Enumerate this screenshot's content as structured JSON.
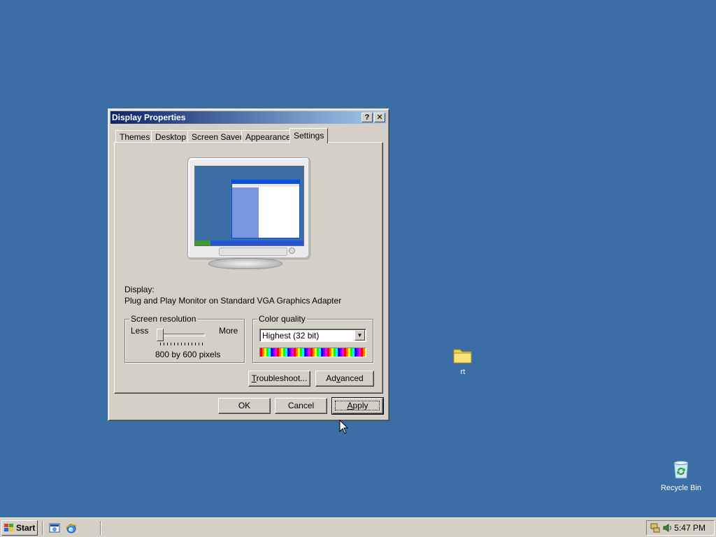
{
  "desktop": {
    "background": "#3a6ea5",
    "icons": [
      {
        "label": "rt",
        "icon": "folder-icon"
      },
      {
        "label": "Recycle Bin",
        "icon": "recycle-bin-icon"
      }
    ]
  },
  "dialog": {
    "title": "Display Properties",
    "help_glyph": "?",
    "close_glyph": "✕",
    "tabs": [
      {
        "label": "Themes"
      },
      {
        "label": "Desktop"
      },
      {
        "label": "Screen Saver"
      },
      {
        "label": "Appearance"
      },
      {
        "label": "Settings",
        "active": true
      }
    ],
    "settings": {
      "display_label": "Display:",
      "display_value": "Plug and Play Monitor on Standard VGA Graphics Adapter",
      "resolution": {
        "legend": "Screen resolution",
        "less": "Less",
        "more": "More",
        "value_text": "800 by 600 pixels",
        "slider_fraction": 0
      },
      "color_quality": {
        "legend": "Color quality",
        "selected": "Highest (32 bit)"
      },
      "troubleshoot_prefix": "T",
      "troubleshoot_rest": "roubleshoot...",
      "advanced_prefix": "Ad",
      "advanced_u": "v",
      "advanced_rest": "anced"
    },
    "buttons": {
      "ok": "OK",
      "cancel": "Cancel",
      "apply_u": "A",
      "apply_rest": "pply"
    }
  },
  "taskbar": {
    "start_label": "Start",
    "quick_launch": [
      "show-desktop-icon",
      "internet-explorer-icon"
    ],
    "tray_icons": [
      "network-tray-icon",
      "volume-tray-icon"
    ],
    "clock": "5:47 PM"
  },
  "colors": {
    "title_active_start": "#0a246a",
    "title_active_end": "#a6caf0",
    "face": "#d4d0c8"
  }
}
